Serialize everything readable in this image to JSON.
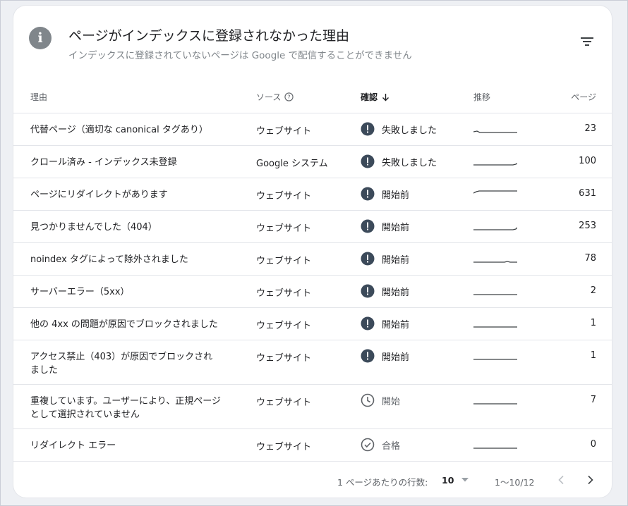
{
  "header": {
    "title": "ページがインデックスに登録されなかった理由",
    "subtitle": "インデックスに登録されていないページは Google で配信することができません",
    "info_icon": "info-icon",
    "filter_icon": "filter-icon"
  },
  "table": {
    "columns": {
      "reason": "理由",
      "source": "ソース",
      "confirm": "確認",
      "trend": "推移",
      "pages": "ページ"
    },
    "rows": [
      {
        "reason": "代替ページ（適切な canonical タグあり）",
        "source": "ウェブサイト",
        "status": "失敗しました",
        "status_icon": "error-icon",
        "pages": "23"
      },
      {
        "reason": "クロール済み - インデックス未登録",
        "source": "Google システム",
        "status": "失敗しました",
        "status_icon": "error-icon",
        "pages": "100"
      },
      {
        "reason": "ページにリダイレクトがあります",
        "source": "ウェブサイト",
        "status": "開始前",
        "status_icon": "error-icon",
        "pages": "631"
      },
      {
        "reason": "見つかりませんでした（404）",
        "source": "ウェブサイト",
        "status": "開始前",
        "status_icon": "error-icon",
        "pages": "253"
      },
      {
        "reason": "noindex タグによって除外されました",
        "source": "ウェブサイト",
        "status": "開始前",
        "status_icon": "error-icon",
        "pages": "78"
      },
      {
        "reason": "サーバーエラー（5xx）",
        "source": "ウェブサイト",
        "status": "開始前",
        "status_icon": "error-icon",
        "pages": "2"
      },
      {
        "reason": "他の 4xx の問題が原因でブロックされました",
        "source": "ウェブサイト",
        "status": "開始前",
        "status_icon": "error-icon",
        "pages": "1"
      },
      {
        "reason": "アクセス禁止（403）が原因でブロックされました",
        "source": "ウェブサイト",
        "status": "開始前",
        "status_icon": "error-icon",
        "pages": "1"
      },
      {
        "reason": "重複しています。ユーザーにより、正規ページとして選択されていません",
        "source": "ウェブサイト",
        "status": "開始",
        "status_icon": "clock-icon",
        "pages": "7"
      },
      {
        "reason": "リダイレクト エラー",
        "source": "ウェブサイト",
        "status": "合格",
        "status_icon": "check-circle-icon",
        "pages": "0"
      }
    ]
  },
  "pagination": {
    "rows_per_page_label": "1 ページあたりの行数:",
    "rows_per_page_value": "10",
    "range": "1〜10/12"
  },
  "colors": {
    "error_icon": "#3c4a5a",
    "muted_icon": "#5f6368",
    "sparkline": "#3c4043"
  }
}
